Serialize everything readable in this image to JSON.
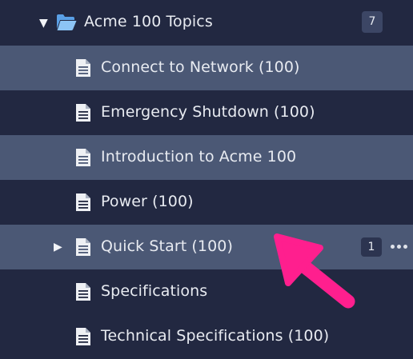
{
  "folder": {
    "label": "Acme 100 Topics",
    "count": "7",
    "expanded": true,
    "icon": "folder-open-icon"
  },
  "topics": [
    {
      "label": "Connect to Network (100)",
      "icon": "document-icon"
    },
    {
      "label": "Emergency Shutdown (100)",
      "icon": "document-icon"
    },
    {
      "label": "Introduction to Acme 100",
      "icon": "document-icon"
    },
    {
      "label": "Power (100)",
      "icon": "document-icon"
    },
    {
      "label": "Quick Start (100)",
      "icon": "document-icon",
      "has_children": true,
      "badge": "1",
      "actions_icon": "more-options-icon"
    },
    {
      "label": "Specifications",
      "icon": "document-icon"
    },
    {
      "label": "Technical Specifications (100)",
      "icon": "document-icon"
    }
  ],
  "annotation": {
    "color": "#ff1f8e",
    "icon": "pointer-arrow"
  },
  "colors": {
    "background": "#222841",
    "highlight": "#4b5875",
    "folder": "#5aa0e6",
    "accent_annotation": "#ff1f8e"
  }
}
